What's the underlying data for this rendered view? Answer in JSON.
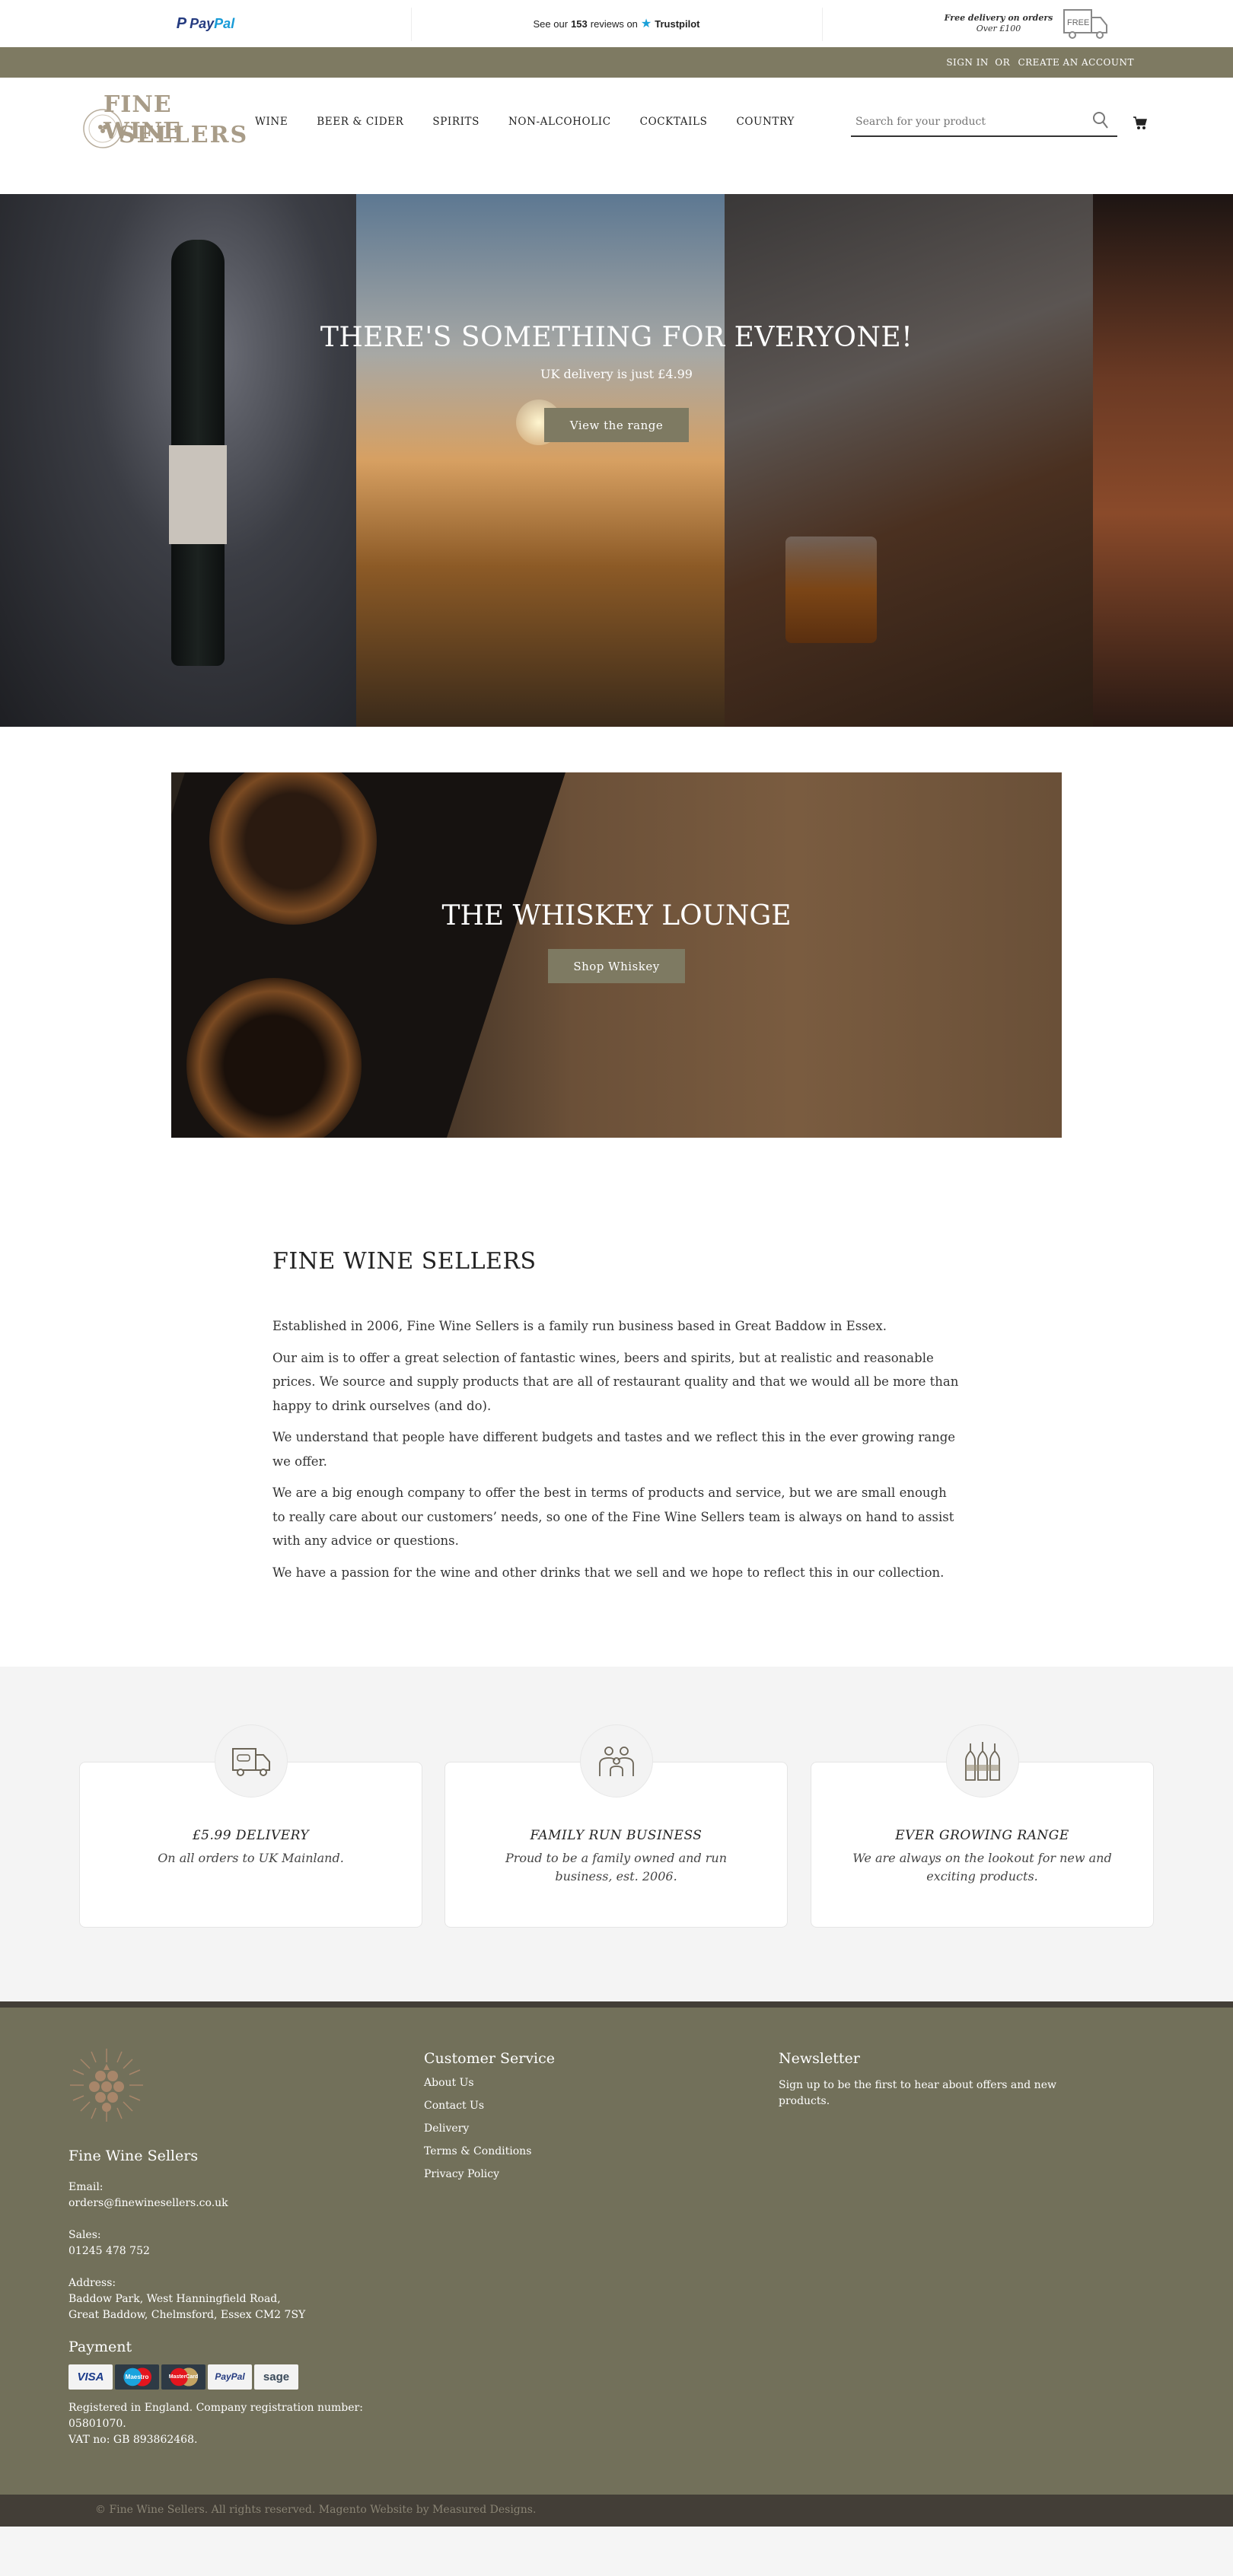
{
  "topbar": {
    "paypal": {
      "pay": "Pay",
      "pal": "Pal"
    },
    "trustpilot": {
      "prefix": "See our",
      "count": "153",
      "middle": "reviews on",
      "brand": "Trustpilot"
    },
    "delivery": {
      "line1": "Free delivery on orders",
      "line2": "Over £100",
      "badge": "FREE"
    }
  },
  "account": {
    "sign_in": "SIGN IN",
    "or": "OR",
    "create": "CREATE AN ACCOUNT"
  },
  "header": {
    "logo": {
      "line1": "FINE WINE",
      "line2": "SELLERS"
    },
    "nav": [
      "WINE",
      "BEER & CIDER",
      "SPIRITS",
      "NON-ALCOHOLIC",
      "COCKTAILS",
      "COUNTRY"
    ],
    "search_placeholder": "Search for your product"
  },
  "hero": {
    "title": "THERE'S SOMETHING FOR EVERYONE!",
    "subtitle": "UK delivery is just £4.99",
    "button": "View the range"
  },
  "whiskey": {
    "title": "THE WHISKEY LOUNGE",
    "button": "Shop Whiskey"
  },
  "about": {
    "title": "FINE WINE SELLERS",
    "paragraphs": [
      "Established in 2006, Fine Wine Sellers is a family run business based in Great Baddow in Essex.",
      "Our aim is to offer a great selection of fantastic wines, beers and spirits, but at realistic and reasonable prices. We source and supply products that are all of restaurant quality and that we would all be more than happy to drink ourselves (and do).",
      "We understand that people have different budgets and tastes and we reflect this in the ever growing range we offer.",
      "We are a big enough company to offer the best in terms of products and service, but we are small enough to really care about our customers’ needs, so one of the Fine Wine Sellers team is always on hand to assist with any advice or questions.",
      "We have a passion for the wine and other drinks that we sell and we hope to reflect this in our collection."
    ]
  },
  "features": [
    {
      "icon": "delivery-truck-icon",
      "title": "£5.99 DELIVERY",
      "text": "On all orders to UK Mainland."
    },
    {
      "icon": "family-icon",
      "title": "FAMILY RUN BUSINESS",
      "text": "Proud to be a family owned and run business, est. 2006."
    },
    {
      "icon": "bottles-icon",
      "title": "EVER GROWING RANGE",
      "text": "We are always on the lookout for new and exciting products."
    }
  ],
  "footer": {
    "company": "Fine Wine Sellers",
    "email_label": "Email:",
    "email": "orders@finewinesellers.co.uk",
    "sales_label": "Sales:",
    "sales": "01245 478 752",
    "address_label": "Address:",
    "address1": "Baddow Park, West Hanningfield Road,",
    "address2": "Great Baddow, Chelmsford, Essex CM2 7SY",
    "payment_title": "Payment",
    "payment_methods": [
      "VISA",
      "Maestro",
      "MasterCard",
      "PayPal",
      "sage"
    ],
    "registered1": "Registered in England. Company registration number:",
    "registered2": "05801070.",
    "vat": "VAT no: GB 893862468.",
    "customer_service": {
      "title": "Customer Service",
      "links": [
        "About Us",
        "Contact Us",
        "Delivery",
        "Terms & Conditions",
        "Privacy Policy"
      ]
    },
    "newsletter": {
      "title": "Newsletter",
      "text": "Sign up to be the first to hear about offers and new products."
    },
    "copyright": "© Fine Wine Sellers. All rights reserved. Magento Website by Measured Designs."
  },
  "colors": {
    "olive": "#7e7a62",
    "footer": "#72705a",
    "dark": "#433e37",
    "logo": "#a89c88"
  }
}
